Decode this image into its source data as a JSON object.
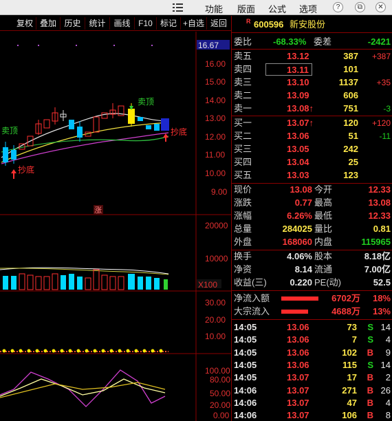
{
  "menu": {
    "items": [
      "功能",
      "版面",
      "公式",
      "选项"
    ],
    "window_controls": [
      "?",
      "⧉",
      "✕"
    ]
  },
  "toolbar": {
    "buttons": [
      "复权",
      "叠加",
      "历史",
      "统计",
      "画线",
      "F10",
      "标记",
      "+自选",
      "返回"
    ]
  },
  "chart": {
    "price_axis": [
      "16.67",
      "16.00",
      "15.00",
      "14.00",
      "13.00",
      "12.00",
      "11.00",
      "10.00",
      "9.00"
    ],
    "volume_axis": [
      "20000",
      "10000",
      "X100"
    ],
    "macd_axis": [
      "30.00",
      "20.00",
      "10.00"
    ],
    "kdj_axis": [
      "100.00",
      "80.00",
      "50.00",
      "20.00",
      "0.00"
    ],
    "signals": {
      "sell_top_right": "卖顶",
      "sell_top_left": "卖顶",
      "buy_bottom_left": "抄底",
      "buy_bottom_right": "抄底",
      "limit_up_tag": "涨"
    }
  },
  "quote": {
    "code_prefix": "R",
    "code": "600596",
    "name": "新安股份",
    "webi_label": "委比",
    "webi_value": "-68.33%",
    "weicha_label": "委差",
    "weicha_value": "-2421",
    "asks": [
      {
        "label": "卖五",
        "price": "13.12",
        "vol": "387",
        "chg": "+387"
      },
      {
        "label": "卖四",
        "price": "13.11",
        "vol": "101",
        "chg": ""
      },
      {
        "label": "卖三",
        "price": "13.10",
        "vol": "1137",
        "chg": "+35"
      },
      {
        "label": "卖二",
        "price": "13.09",
        "vol": "606",
        "chg": ""
      },
      {
        "label": "卖一",
        "price": "13.08↑",
        "vol": "751",
        "chg": "-3"
      }
    ],
    "bids": [
      {
        "label": "买一",
        "price": "13.07↑",
        "vol": "120",
        "chg": "+120"
      },
      {
        "label": "买二",
        "price": "13.06",
        "vol": "51",
        "chg": "-11"
      },
      {
        "label": "买三",
        "price": "13.05",
        "vol": "242",
        "chg": ""
      },
      {
        "label": "买四",
        "price": "13.04",
        "vol": "25",
        "chg": ""
      },
      {
        "label": "买五",
        "price": "13.03",
        "vol": "123",
        "chg": ""
      }
    ],
    "stats": [
      {
        "l1": "现价",
        "v1": "13.08",
        "l2": "今开",
        "v2": "12.33"
      },
      {
        "l1": "涨跌",
        "v1": "0.77",
        "l2": "最高",
        "v2": "13.08"
      },
      {
        "l1": "涨幅",
        "v1": "6.26%",
        "l2": "最低",
        "v2": "12.33"
      },
      {
        "l1": "总量",
        "v1": "284025",
        "l2": "量比",
        "v2": "0.81"
      },
      {
        "l1": "外盘",
        "v1": "168060",
        "l2": "内盘",
        "v2": "115965"
      }
    ],
    "stats2": [
      {
        "l1": "换手",
        "v1": "4.06%",
        "l2": "股本",
        "v2": "8.18亿"
      },
      {
        "l1": "净资",
        "v1": "8.14",
        "l2": "流通",
        "v2": "7.00亿"
      },
      {
        "l1": "收益(三)",
        "v1": "0.220",
        "l2": "PE(动)",
        "v2": "52.5"
      }
    ],
    "flows": [
      {
        "label": "净流入额",
        "value": "6702万",
        "pct": "18%",
        "bar_fraction": 0.18
      },
      {
        "label": "大宗流入",
        "value": "4688万",
        "pct": "13%",
        "bar_fraction": 0.13
      }
    ],
    "ticks": [
      {
        "time": "14:05",
        "price": "13.06",
        "vol": "73",
        "side": "S",
        "n": "14"
      },
      {
        "time": "14:05",
        "price": "13.06",
        "vol": "7",
        "side": "S",
        "n": "4"
      },
      {
        "time": "14:05",
        "price": "13.06",
        "vol": "102",
        "side": "B",
        "n": "9"
      },
      {
        "time": "14:05",
        "price": "13.06",
        "vol": "115",
        "side": "S",
        "n": "14"
      },
      {
        "time": "14:05",
        "price": "13.07",
        "vol": "17",
        "side": "B",
        "n": "2"
      },
      {
        "time": "14:06",
        "price": "13.07",
        "vol": "271",
        "side": "B",
        "n": "26"
      },
      {
        "time": "14:06",
        "price": "13.07",
        "vol": "47",
        "side": "B",
        "n": "4"
      },
      {
        "time": "14:06",
        "price": "13.07",
        "vol": "106",
        "side": "B",
        "n": "8"
      }
    ]
  }
}
